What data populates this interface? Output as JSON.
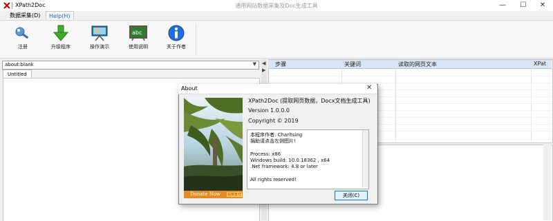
{
  "window": {
    "app_title": "XPath2Doc",
    "center_title": "通用网站数据采集及Doc生成工具",
    "controls": {
      "minimize": "—",
      "maximize": "☐",
      "close": "✕"
    }
  },
  "menu_tabs": [
    {
      "label": "数据采集(D)",
      "active": false
    },
    {
      "label": "Help(H)",
      "active": true
    }
  ],
  "ribbon": {
    "buttons": [
      {
        "label": "注册",
        "icon": "key-icon"
      },
      {
        "label": "升级程序",
        "icon": "down-arrow-icon"
      },
      {
        "label": "操作演示",
        "icon": "presentation-board-icon"
      },
      {
        "label": "使用说明",
        "icon": "chalkboard-abc-icon"
      },
      {
        "label": "关于作者",
        "icon": "info-icon"
      }
    ]
  },
  "browser": {
    "address": "about:blank",
    "tab_label": "Untitled"
  },
  "splitter": {
    "left_arrow": "◀",
    "right_arrow": "▶"
  },
  "grid": {
    "columns": [
      "步骤",
      "关键词",
      "读取的网页文本",
      "XPat"
    ]
  },
  "dialog": {
    "title": "About",
    "close": "✕",
    "product_line": "XPath2Doc (提取网页数据，Docx文档生成工具)",
    "version_line": "Version 1.0.0.0",
    "copyright_line": "Copyright ©  2019",
    "info_lines": [
      "本程序作者: Charltsing",
      "捐助请点击左侧图片!",
      "",
      "Process: x86",
      "Windows build: 10.0.18362 , x64",
      ".Net framework: 4.8 or later",
      "",
      "All rights reserved!"
    ],
    "donate_label": "Donate Now",
    "donate_small": "左侧支付",
    "ok_button": "关闭(C)"
  }
}
